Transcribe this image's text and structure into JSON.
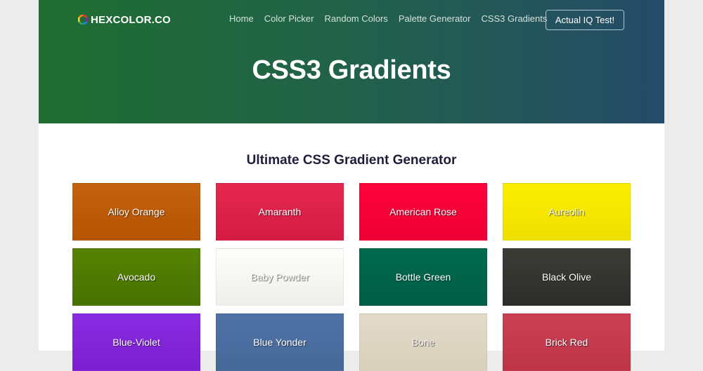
{
  "brand": {
    "name": "HEXCOLOR.CO",
    "icon": "color-wheel-icon"
  },
  "nav": {
    "items": [
      {
        "label": "Home"
      },
      {
        "label": "Color Picker"
      },
      {
        "label": "Random Colors"
      },
      {
        "label": "Palette Generator"
      },
      {
        "label": "CSS3 Gradients"
      }
    ],
    "cta_label": "Actual IQ Test!"
  },
  "hero": {
    "title": "CSS3 Gradients"
  },
  "section": {
    "title": "Ultimate CSS Gradient Generator"
  },
  "gradients": [
    {
      "name": "Alloy Orange",
      "from": "#c4620f",
      "to": "#b55400"
    },
    {
      "name": "Amaranth",
      "from": "#e5284f",
      "to": "#d41b44"
    },
    {
      "name": "American Rose",
      "from": "#ff033e",
      "to": "#ee0033"
    },
    {
      "name": "Aureolin",
      "from": "#fdee00",
      "to": "#ede000"
    },
    {
      "name": "Avocado",
      "from": "#568203",
      "to": "#487200"
    },
    {
      "name": "Baby Powder",
      "from": "#fefefa",
      "to": "#eeeeea"
    },
    {
      "name": "Bottle Green",
      "from": "#006a4e",
      "to": "#005e44"
    },
    {
      "name": "Black Olive",
      "from": "#3b3c36",
      "to": "#2d2e29"
    },
    {
      "name": "Blue-Violet",
      "from": "#8a2be2",
      "to": "#7a20d0"
    },
    {
      "name": "Blue Yonder",
      "from": "#5072a7",
      "to": "#466898"
    },
    {
      "name": "Bone",
      "from": "#e3dac9",
      "to": "#d8cfbc"
    },
    {
      "name": "Brick Red",
      "from": "#cb4154",
      "to": "#bd3448"
    }
  ],
  "colors": {
    "header_start": "#1f6e31",
    "header_end": "#254b69",
    "section_title": "#1e1e3a"
  }
}
